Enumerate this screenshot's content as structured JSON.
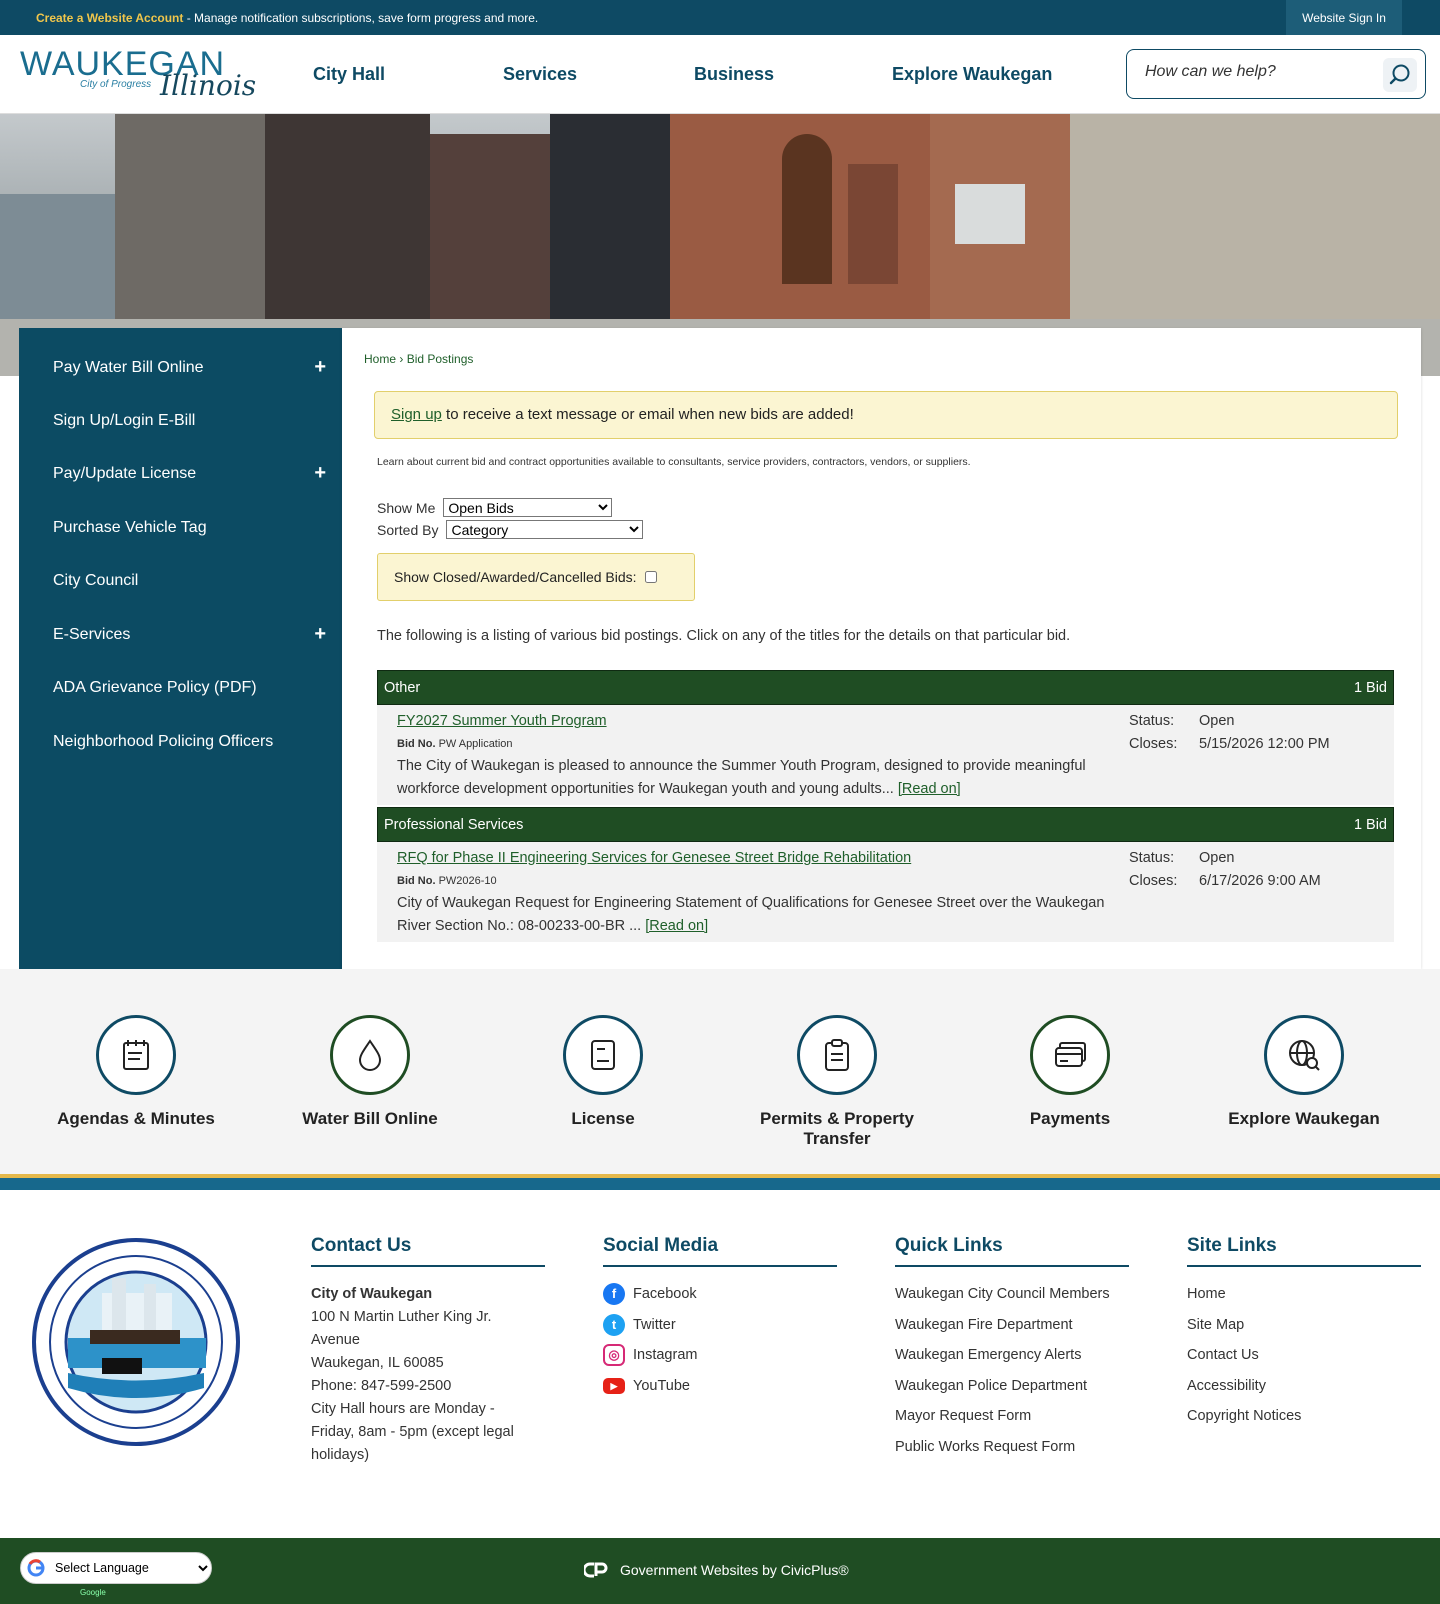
{
  "topbar": {
    "create_account": "Create a Website Account",
    "message": " - Manage notification subscriptions, save form progress and more.",
    "sign_in": "Website Sign In"
  },
  "header": {
    "logo_word": "WAUKEGAN",
    "logo_sub": "City of Progress",
    "logo_script": "Illinois",
    "nav": [
      "City Hall",
      "Services",
      "Business",
      "Explore Waukegan"
    ],
    "search_placeholder": "How can we help?"
  },
  "sidebar": {
    "items": [
      {
        "label": "Pay Water Bill Online",
        "expandable": true
      },
      {
        "label": "Sign Up/Login E-Bill",
        "expandable": false
      },
      {
        "label": "Pay/Update License",
        "expandable": true
      },
      {
        "label": "Purchase Vehicle Tag",
        "expandable": false
      },
      {
        "label": "City Council",
        "expandable": false
      },
      {
        "label": "E-Services",
        "expandable": true
      },
      {
        "label": "ADA Grievance Policy (PDF)",
        "expandable": false
      },
      {
        "label": "Neighborhood Policing Officers",
        "expandable": false
      }
    ],
    "plus": "+"
  },
  "breadcrumb": {
    "home": "Home",
    "sep": "›",
    "current": "Bid Postings"
  },
  "notice": {
    "link": "Sign up",
    "text": " to receive a text message or email when new bids are added!"
  },
  "learn_text": "Learn about current bid and contract opportunities available to consultants, service providers, contractors, vendors, or suppliers.",
  "filters": {
    "show_me_label": "Show Me",
    "show_me_value": "Open Bids",
    "sorted_by_label": "Sorted By",
    "sorted_by_value": "Category",
    "closed_label": "Show Closed/Awarded/Cancelled Bids:"
  },
  "intro": "The following is a listing of various bid postings. Click on any of the titles for the details on that particular bid.",
  "categories": [
    {
      "name": "Other",
      "count": "1 Bid",
      "bid": {
        "title": "FY2027 Summer Youth Program",
        "bid_no_label": "Bid No.",
        "bid_no": "PW Application",
        "desc": "The City of Waukegan is pleased to announce the Summer Youth Program, designed to provide meaningful workforce development opportunities for Waukegan youth and young adults... ",
        "read_on": "[Read on]",
        "status_label": "Status:",
        "status": "Open",
        "closes_label": "Closes:",
        "closes": "5/15/2026 12:00 PM"
      }
    },
    {
      "name": "Professional Services",
      "count": "1 Bid",
      "bid": {
        "title": "RFQ for Phase II Engineering Services for Genesee Street Bridge Rehabilitation",
        "bid_no_label": "Bid No.",
        "bid_no": "PW2026-10",
        "desc": "City of Waukegan Request for Engineering Statement of Qualifications for Genesee Street over the Waukegan River Section No.: 08-00233-00-BR ... ",
        "read_on": "[Read on]",
        "status_label": "Status:",
        "status": "Open",
        "closes_label": "Closes:",
        "closes": "6/17/2026 9:00 AM"
      }
    }
  ],
  "quick_links": [
    {
      "label": "Agendas & Minutes",
      "icon": "notepad-icon"
    },
    {
      "label": "Water Bill Online",
      "icon": "water-drop-icon"
    },
    {
      "label": "License",
      "icon": "document-icon"
    },
    {
      "label": "Permits & Property Transfer",
      "icon": "clipboard-icon"
    },
    {
      "label": "Payments",
      "icon": "credit-card-icon"
    },
    {
      "label": "Explore Waukegan",
      "icon": "globe-search-icon"
    }
  ],
  "footer": {
    "contact": {
      "heading": "Contact Us",
      "name": "City of Waukegan",
      "lines": [
        "100 N Martin Luther King Jr.",
        "Avenue",
        "Waukegan, IL 60085",
        "Phone: 847-599-2500",
        "City Hall hours are Monday -",
        "Friday, 8am - 5pm (except legal",
        "holidays)"
      ]
    },
    "social": {
      "heading": "Social Media",
      "items": [
        "Facebook",
        "Twitter",
        "Instagram",
        "YouTube"
      ]
    },
    "quick": {
      "heading": "Quick Links",
      "items": [
        "Waukegan City Council Members",
        "Waukegan Fire Department",
        "Waukegan Emergency Alerts",
        "Waukegan Police Department",
        "Mayor Request Form",
        "Public Works Request Form"
      ]
    },
    "site": {
      "heading": "Site Links",
      "items": [
        "Home",
        "Site Map",
        "Contact Us",
        "Accessibility",
        "Copyright Notices"
      ]
    }
  },
  "bottom": {
    "language": "Select Language",
    "powered": "Google",
    "civic": "Government Websites by CivicPlus®"
  },
  "colors": {
    "navy": "#0e4a64",
    "green": "#1f4d23",
    "gold": "#e4b84b",
    "notice_bg": "#fbf5d2"
  }
}
